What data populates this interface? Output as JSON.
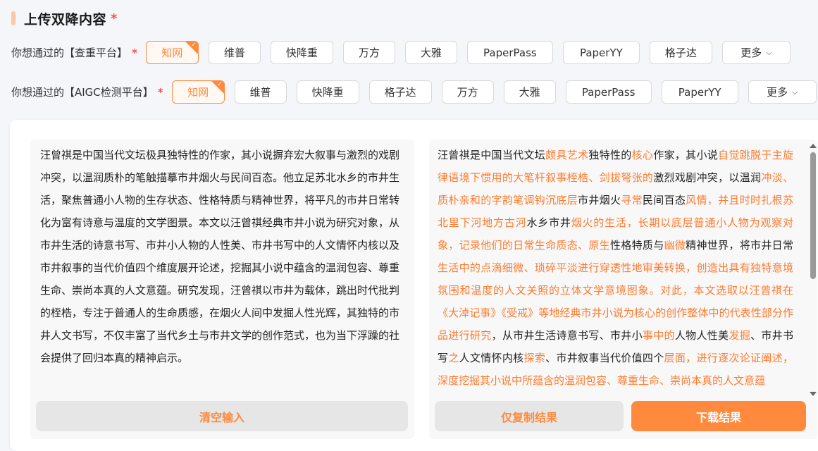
{
  "header": {
    "title": "上传双降内容",
    "required_mark": "*"
  },
  "plagiarism_row": {
    "label": "你想通过的【查重平台】",
    "required_mark": "*",
    "options": [
      "知网",
      "维普",
      "快降重",
      "万方",
      "大雅",
      "PaperPass",
      "PaperYY",
      "格子达"
    ],
    "more_label": "更多",
    "selected": "知网"
  },
  "aigc_row": {
    "label": "你想通过的【AIGC检测平台】",
    "required_mark": "*",
    "options": [
      "知网",
      "维普",
      "快降重",
      "格子达",
      "万方",
      "大雅",
      "PaperPass",
      "PaperYY"
    ],
    "more_label": "更多",
    "selected": "知网"
  },
  "input": {
    "text": "汪曾祺是中国当代文坛极具独特性的作家，其小说摒弃宏大叙事与激烈的戏剧冲突，以温润质朴的笔触描摹市井烟火与民间百态。他立足苏北水乡的市井生活，聚焦普通小人物的生存状态、性格特质与精神世界，将平凡的市井日常转化为富有诗意与温度的文学图景。本文以汪曾祺经典市井小说为研究对象，从市井生活的诗意书写、市井小人物的人性美、市井书写中的人文情怀内核以及市井叙事的当代价值四个维度展开论述，挖掘其小说中蕴含的温润包容、尊重生命、崇尚本真的人文意蕴。研究发现，汪曾祺以市井为载体，跳出时代批判的桎梏，专注于普通人的生命质感，在烟火人间中发掘人性光辉，其独特的市井人文书写，不仅丰富了当代乡土与市井文学的创作范式，也为当下浮躁的社会提供了回归本真的精神启示。",
    "clear_label": "清空输入"
  },
  "output": {
    "segments": [
      {
        "t": "汪曾祺是中国当代文坛",
        "h": false
      },
      {
        "t": "颇具艺术",
        "h": true
      },
      {
        "t": "独特性的",
        "h": false
      },
      {
        "t": "核心",
        "h": true
      },
      {
        "t": "作家，其小说",
        "h": false
      },
      {
        "t": "自觉跳脱于主旋律语境下惯用的大笔杆叙事桎梏、剑拔弩张的",
        "h": true
      },
      {
        "t": "激烈戏剧冲突，以温润",
        "h": false
      },
      {
        "t": "冲淡、质朴亲和的字韵笔调钩沉底层",
        "h": true
      },
      {
        "t": "市井烟火",
        "h": false
      },
      {
        "t": "寻常",
        "h": true
      },
      {
        "t": "民间百态",
        "h": false
      },
      {
        "t": "风情，并且时时扎根苏北里下河地方古河",
        "h": true
      },
      {
        "t": "水乡市井",
        "h": false
      },
      {
        "t": "烟火的生活，长期以底层普通小人物为观察对象，记录他们的日常生命质态、原生",
        "h": true
      },
      {
        "t": "性格特质与",
        "h": false
      },
      {
        "t": "幽微",
        "h": true
      },
      {
        "t": "精神世界，将市井日常",
        "h": false
      },
      {
        "t": "生活中的点滴细微、琐碎平淡进行穿透性地审美转换，创造出具有独特意境氛围和温度的人文关照的立体文学意境图象。对此，本文选取以汪曾祺在《大淖记事》《受戒》等地经典市井小说为核心的创作整体中的代表性部分作品进行研究",
        "h": true
      },
      {
        "t": "，从市井生活诗意书写、市井小",
        "h": false
      },
      {
        "t": "事中的",
        "h": true
      },
      {
        "t": "人物人性美",
        "h": false
      },
      {
        "t": "发掘",
        "h": true
      },
      {
        "t": "、市井书写",
        "h": false
      },
      {
        "t": "之",
        "h": true
      },
      {
        "t": "人文情怀内核",
        "h": false
      },
      {
        "t": "探索",
        "h": true
      },
      {
        "t": "、市井叙事当代价值四个",
        "h": false
      },
      {
        "t": "层面，进行逐次论证阐述，深度挖掘其小说中所蕴含的温润包容、尊重生命、崇尚本真的人文意蕴",
        "h": true
      }
    ],
    "copy_label": "仅复制结果",
    "download_label": "下载结果"
  },
  "colors": {
    "accent": "#ff8a3d",
    "required": "#ff4d4f",
    "highlight": "#ff7a2e"
  }
}
